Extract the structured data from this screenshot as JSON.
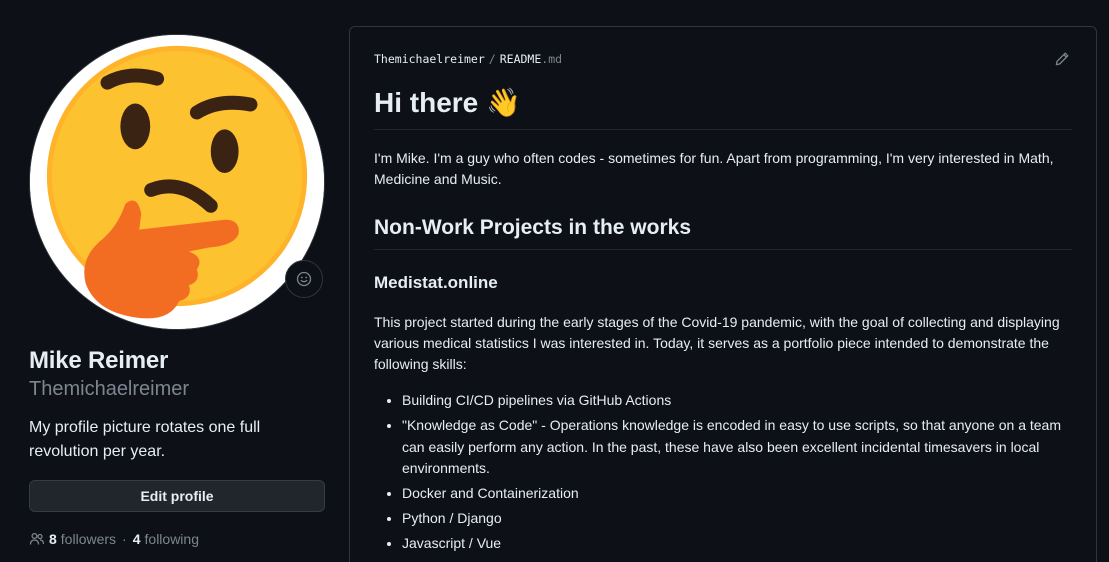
{
  "profile": {
    "full_name": "Mike Reimer",
    "username": "Themichaelreimer",
    "bio": "My profile picture rotates one full revolution per year.",
    "edit_label": "Edit profile",
    "followers_count": "8",
    "followers_label": "followers",
    "following_count": "4",
    "following_label": "following",
    "status_icon": "smiley-icon",
    "avatar": "thinking-face-emoji"
  },
  "readme": {
    "owner": "Themichaelreimer",
    "separator": "/",
    "filename": "README",
    "extension": ".md",
    "title": "Hi there",
    "title_emoji": "👋",
    "intro": "I'm Mike. I'm a guy who often codes - sometimes for fun. Apart from programming, I'm very interested in Math, Medicine and Music.",
    "section_title": "Non-Work Projects in the works",
    "project_title": "Medistat.online",
    "project_desc": "This project started during the early stages of the Covid-19 pandemic, with the goal of collecting and displaying various medical statistics I was interested in. Today, it serves as a portfolio piece intended to demonstrate the following skills:",
    "skills": [
      "Building CI/CD pipelines via GitHub Actions",
      "\"Knowledge as Code\" - Operations knowledge is encoded in easy to use scripts, so that anyone on a team can easily perform any action. In the past, these have also been excellent incidental timesavers in local environments.",
      "Docker and Containerization",
      "Python / Django",
      "Javascript / Vue"
    ]
  },
  "colors": {
    "background": "#0d1117",
    "border": "#30363d",
    "text": "#e6edf3",
    "muted": "#7d8590",
    "button_bg": "#21262d"
  }
}
